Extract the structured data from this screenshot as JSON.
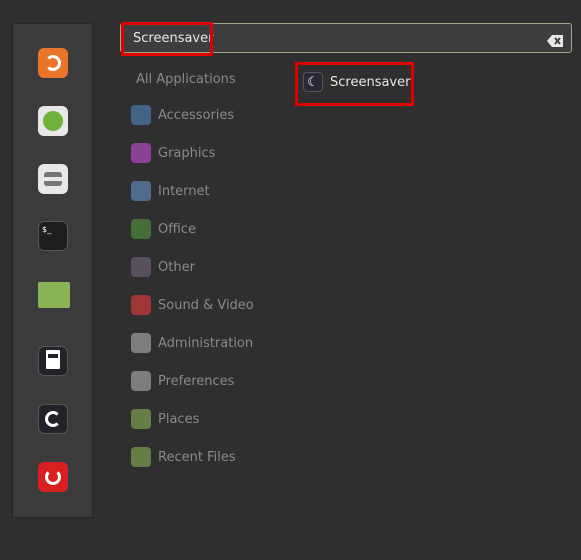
{
  "sidebar": {
    "favorites": [
      {
        "name": "firefox",
        "icon": "firefox-icon",
        "color": "#e8752a"
      },
      {
        "name": "software-manager",
        "icon": "grid-icon",
        "color": "#e8e8e8"
      },
      {
        "name": "settings",
        "icon": "toggle-icon",
        "color": "#e8e8e8"
      },
      {
        "name": "terminal",
        "icon": "terminal-icon",
        "color": "#1e1e1e",
        "glyph": "$_"
      },
      {
        "name": "files",
        "icon": "folder-icon",
        "color": "#8ab356"
      },
      {
        "name": "lock-screen",
        "icon": "lock-icon",
        "color": "#222228"
      },
      {
        "name": "logout",
        "icon": "logout-icon",
        "color": "#222228"
      },
      {
        "name": "shutdown",
        "icon": "power-icon",
        "color": "#d92020"
      }
    ]
  },
  "search": {
    "value": "Screensaver",
    "placeholder": ""
  },
  "categories": {
    "all": "All Applications",
    "items": [
      {
        "label": "Accessories",
        "color": "#4a7cad"
      },
      {
        "label": "Graphics",
        "color": "#b04ac0"
      },
      {
        "label": "Internet",
        "color": "#5d86b8"
      },
      {
        "label": "Office",
        "color": "#4e8a3a"
      },
      {
        "label": "Other",
        "color": "#6a6070"
      },
      {
        "label": "Sound & Video",
        "color": "#d03838"
      },
      {
        "label": "Administration",
        "color": "#a0a0a0"
      },
      {
        "label": "Preferences",
        "color": "#a0a0a0"
      },
      {
        "label": "Places",
        "color": "#7aa04e"
      },
      {
        "label": "Recent Files",
        "color": "#7aa04e"
      }
    ]
  },
  "results": [
    {
      "label": "Screensaver",
      "icon": "moon-icon"
    }
  ],
  "highlight_color": "#e00000"
}
